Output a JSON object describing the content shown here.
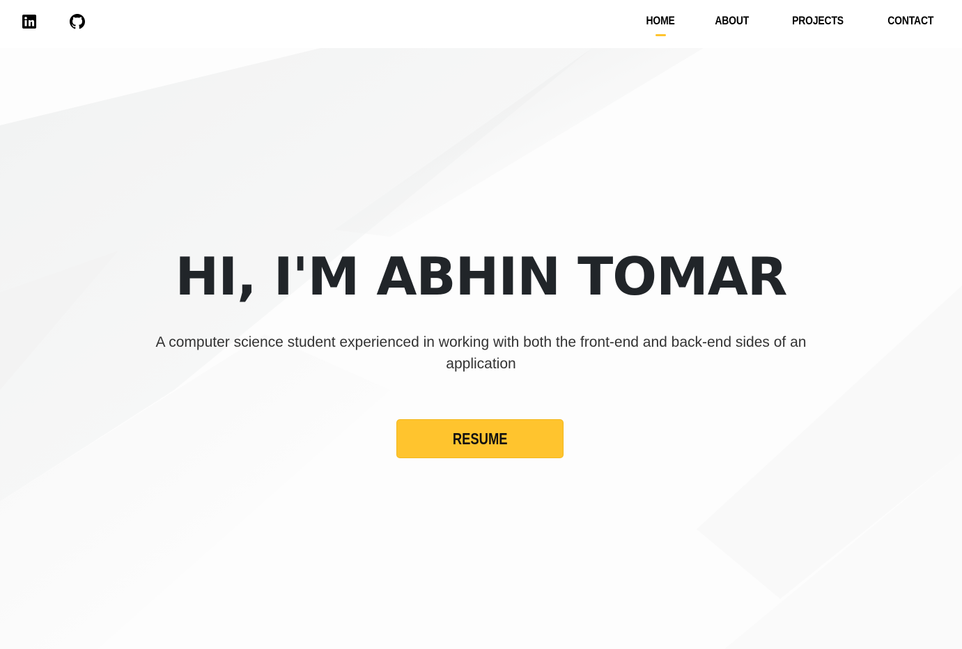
{
  "header": {
    "social": [
      {
        "name": "linkedin",
        "icon": "linkedin-icon"
      },
      {
        "name": "github",
        "icon": "github-icon"
      }
    ],
    "nav": [
      {
        "label": "HOME",
        "active": true
      },
      {
        "label": "ABOUT",
        "active": false
      },
      {
        "label": "PROJECTS",
        "active": false
      },
      {
        "label": "CONTACT",
        "active": false
      }
    ]
  },
  "hero": {
    "title": "HI, I'M ABHIN TOMAR",
    "subtitle": "A computer science student experienced in working with both the front-end and back-end sides of an application",
    "button_label": "RESUME"
  },
  "colors": {
    "accent": "#ffc42e",
    "text_dark": "#212529",
    "background": "#ffffff"
  }
}
